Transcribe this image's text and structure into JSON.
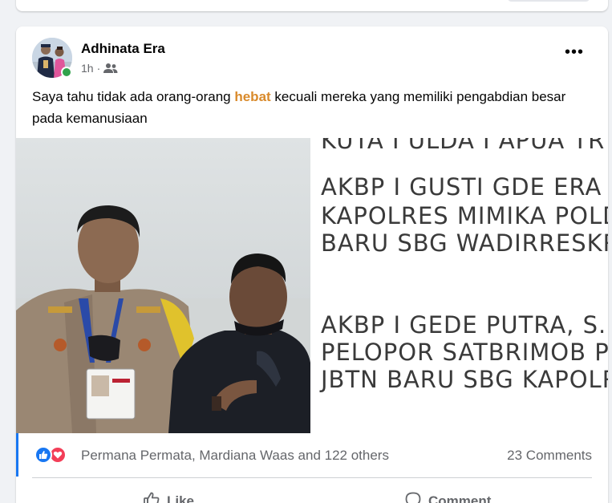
{
  "post": {
    "author": "Adhinata Era",
    "time": "1h",
    "separator": "·",
    "audience_icon": "friends-icon",
    "more_label": "•••",
    "caption_before": "Saya tahu tidak ada orang-orang ",
    "caption_highlight": "hebat",
    "caption_after": " kecuali mereka yang memiliki pengabdian besar pada kemanusiaan",
    "highlight_color": "#d98a2b",
    "image_text": {
      "line1": "KUTA I ULDA I APUA TR",
      "line2": "AKBP I GUSTI GDE ERA",
      "line3": "KAPOLRES MIMIKA POLD",
      "line4": "BARU SBG WADIRRESKR",
      "line5": "AKBP I GEDE PUTRA, S.H",
      "line6": "PELOPOR SATBRIMOB P",
      "line7": "JBTN BARU SBG KAPOLR"
    }
  },
  "reactions": {
    "icons": [
      "like-icon",
      "love-icon"
    ],
    "names": "Permana Permata, Mardiana Waas and 122 others",
    "comments": "23 Comments"
  },
  "actions": {
    "like_label": "Like",
    "comment_label": "Comment"
  },
  "colors": {
    "accent": "#1877f2",
    "love": "#f33e58",
    "online": "#31a24c",
    "secondary_text": "#65676b"
  }
}
